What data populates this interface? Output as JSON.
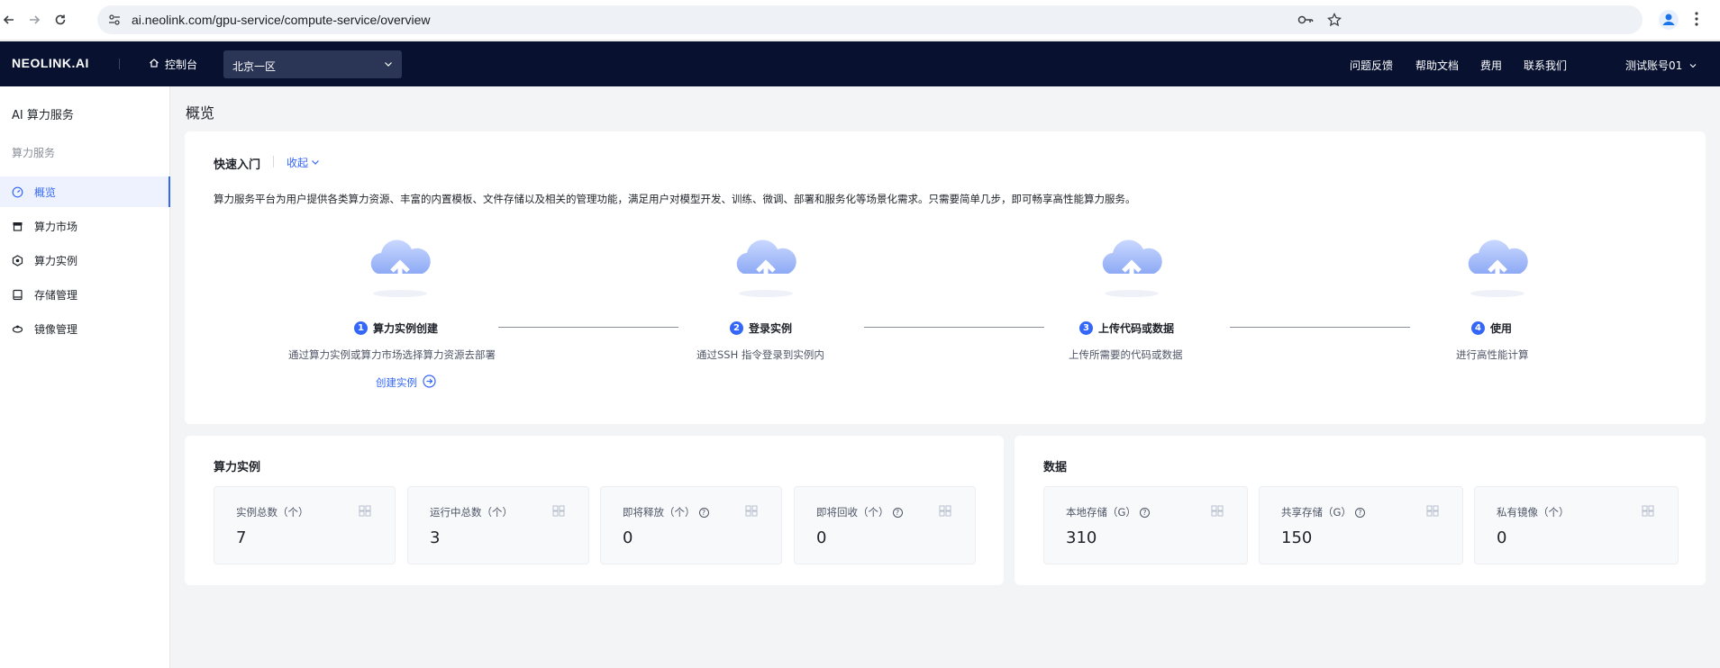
{
  "browser": {
    "url": "ai.neolink.com/gpu-service/compute-service/overview"
  },
  "topnav": {
    "logo": "NEOLINK.AI",
    "console": "控制台",
    "region": "北京一区",
    "links": [
      "问题反馈",
      "帮助文档",
      "费用",
      "联系我们"
    ],
    "account": "测试账号01"
  },
  "sidebar": {
    "title": "AI 算力服务",
    "group": "算力服务",
    "items": [
      {
        "label": "概览",
        "icon": "dashboard-icon",
        "active": true
      },
      {
        "label": "算力市场",
        "icon": "market-icon",
        "active": false
      },
      {
        "label": "算力实例",
        "icon": "instance-icon",
        "active": false
      },
      {
        "label": "存储管理",
        "icon": "storage-icon",
        "active": false
      },
      {
        "label": "镜像管理",
        "icon": "image-icon",
        "active": false
      }
    ]
  },
  "page": {
    "title": "概览"
  },
  "quickstart": {
    "title": "快速入门",
    "collapse": "收起",
    "desc": "算力服务平台为用户提供各类算力资源、丰富的内置模板、文件存储以及相关的管理功能，满足用户对模型开发、训练、微调、部署和服务化等场景化需求。只需要简单几步，即可畅享高性能算力服务。",
    "steps": [
      {
        "num": "1",
        "title": "算力实例创建",
        "desc": "通过算力实例或算力市场选择算力资源去部署",
        "link": "创建实例"
      },
      {
        "num": "2",
        "title": "登录实例",
        "desc": "通过SSH 指令登录到实例内"
      },
      {
        "num": "3",
        "title": "上传代码或数据",
        "desc": "上传所需要的代码或数据"
      },
      {
        "num": "4",
        "title": "使用",
        "desc": "进行高性能计算"
      }
    ]
  },
  "compute": {
    "title": "算力实例",
    "stats": [
      {
        "label": "实例总数（个）",
        "value": "7",
        "help": false
      },
      {
        "label": "运行中总数（个）",
        "value": "3",
        "help": false
      },
      {
        "label": "即将释放（个）",
        "value": "0",
        "help": true
      },
      {
        "label": "即将回收（个）",
        "value": "0",
        "help": true
      }
    ]
  },
  "data": {
    "title": "数据",
    "stats": [
      {
        "label": "本地存储（G）",
        "value": "310",
        "help": true
      },
      {
        "label": "共享存储（G）",
        "value": "150",
        "help": true
      },
      {
        "label": "私有镜像（个）",
        "value": "0",
        "help": false
      }
    ]
  },
  "colors": {
    "accent": "#3467f7",
    "nav_bg": "#081230"
  }
}
